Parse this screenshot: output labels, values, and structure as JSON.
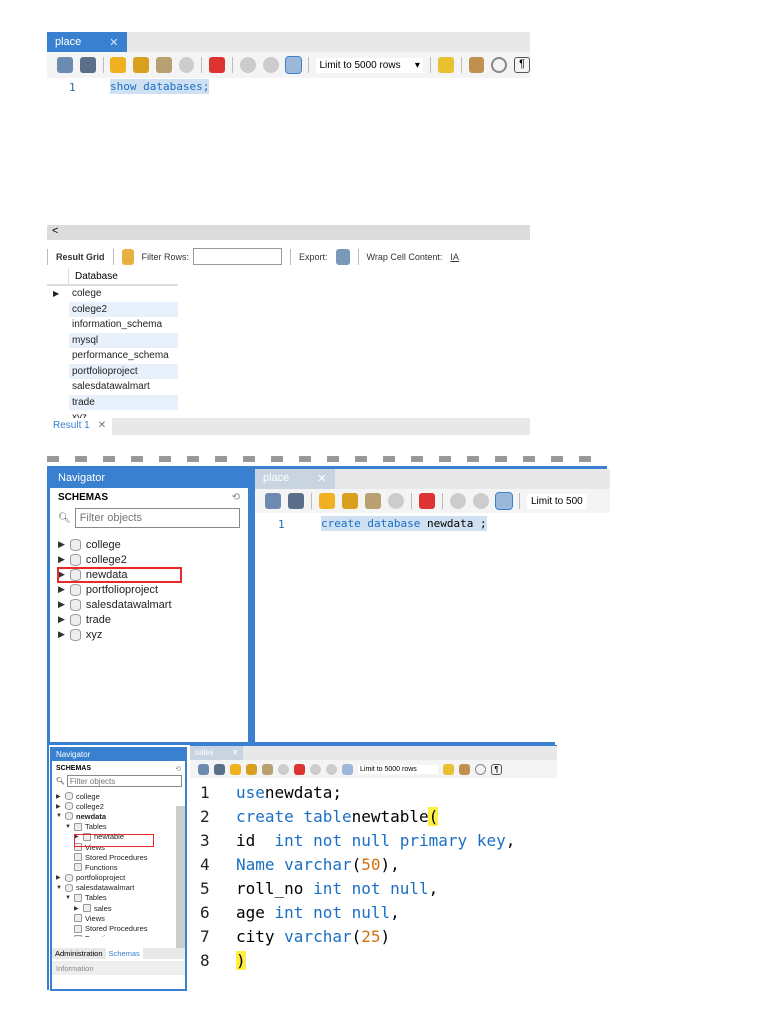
{
  "shot1": {
    "tab": "place",
    "limit": "Limit to 5000 rows",
    "line_no": "1",
    "sql": "show databases;",
    "result_toolbar": {
      "result_grid": "Result Grid",
      "filter_rows": "Filter Rows:",
      "export": "Export:",
      "wrap": "Wrap Cell Content:"
    },
    "column": "Database",
    "rows": [
      "colege",
      "colege2",
      "information_schema",
      "mysql",
      "performance_schema",
      "portfolioproject",
      "salesdatawalmart",
      "trade",
      "xyz"
    ],
    "result_tab": "Result 1",
    "scroll_left": "<"
  },
  "shot2": {
    "navigator": "Navigator",
    "schemas": "SCHEMAS",
    "filter_placeholder": "Filter objects",
    "tree": [
      "college",
      "college2",
      "newdata",
      "portfolioproject",
      "salesdatawalmart",
      "trade",
      "xyz"
    ],
    "tab": "place",
    "limit": "Limit to 500",
    "line_no": "1",
    "sql_kw": "create database",
    "sql_rest": " newdata ;"
  },
  "shot3": {
    "navigator": "Navigator",
    "schemas": "SCHEMAS",
    "filter_placeholder": "Filter objects",
    "tree": [
      "college",
      "college2",
      "newdata",
      "Tables",
      "newtable",
      "Views",
      "Stored Procedures",
      "Functions",
      "portfolioproject",
      "salesdatawalmart",
      "Tables",
      "sales",
      "Views",
      "Stored Procedures",
      "Functions"
    ],
    "bottom_tabs": [
      "Administration",
      "Schemas"
    ],
    "information": "Information",
    "tab": "sales",
    "limit": "Limit to 5000 rows",
    "code": [
      {
        "n": "1",
        "parts": [
          [
            "kw",
            "use"
          ],
          [
            "",
            "newdata;"
          ]
        ]
      },
      {
        "n": "2",
        "parts": [
          [
            "kw",
            "create table"
          ],
          [
            "",
            "newtable("
          ]
        ]
      },
      {
        "n": "3",
        "parts": [
          [
            "",
            "id  "
          ],
          [
            "kw",
            "int not null primary key"
          ],
          [
            "",
            ","
          ]
        ]
      },
      {
        "n": "4",
        "parts": [
          [
            "kw",
            "Name varchar"
          ],
          [
            "",
            "("
          ],
          [
            "num",
            "50"
          ],
          [
            "",
            "),"
          ]
        ]
      },
      {
        "n": "5",
        "parts": [
          [
            "",
            "roll_no "
          ],
          [
            "kw",
            "int not null"
          ],
          [
            "",
            ","
          ]
        ]
      },
      {
        "n": "6",
        "parts": [
          [
            "",
            "age "
          ],
          [
            "kw",
            "int not null"
          ],
          [
            "",
            ","
          ]
        ]
      },
      {
        "n": "7",
        "parts": [
          [
            "",
            "city "
          ],
          [
            "kw",
            "varchar"
          ],
          [
            "",
            "("
          ],
          [
            "num",
            "25"
          ],
          [
            "",
            ")"
          ]
        ]
      },
      {
        "n": "8",
        "parts": [
          [
            "",
            ")"
          ]
        ]
      }
    ]
  },
  "colors": {
    "accent": "#3a80d0",
    "highlight": "#e8282b"
  }
}
